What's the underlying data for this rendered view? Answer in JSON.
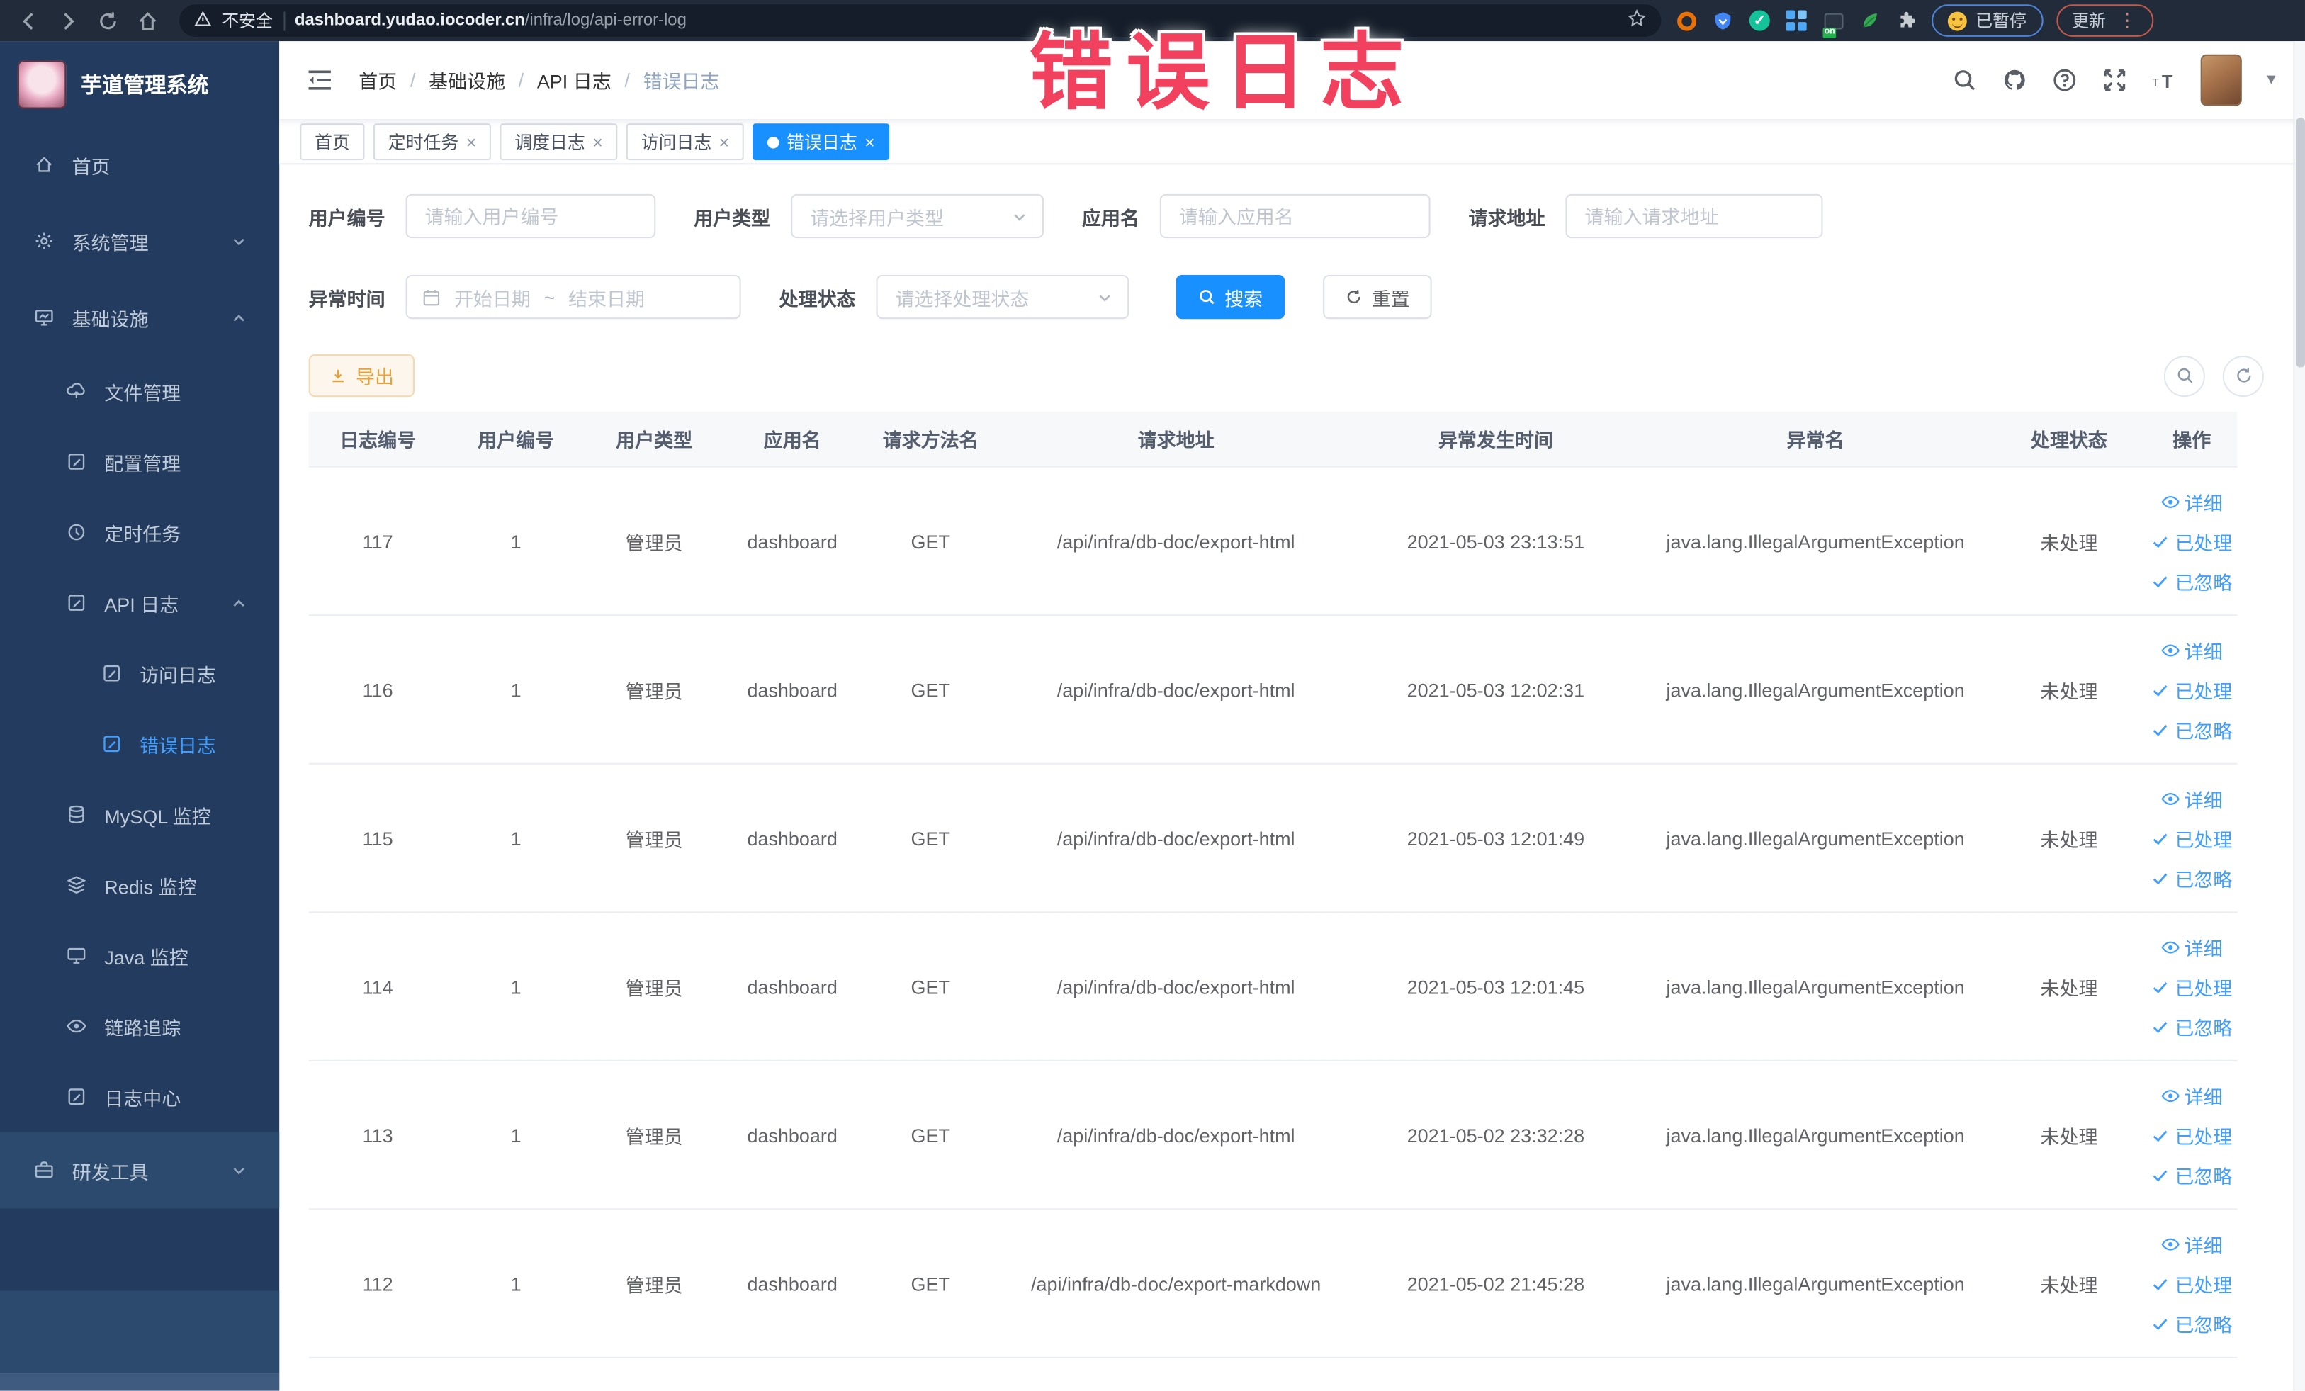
{
  "browser": {
    "security_label": "不安全",
    "url_domain": "dashboard.yudao.iocoder.cn",
    "url_path": "/infra/log/api-error-log",
    "paused_badge": "已暂停",
    "update_badge": "更新"
  },
  "watermark": "错误日志",
  "sidebar": {
    "app_title": "芋道管理系统",
    "items": [
      {
        "id": "home",
        "label": "首页",
        "icon": "home-icon",
        "level": 1
      },
      {
        "id": "system",
        "label": "系统管理",
        "icon": "gear-icon",
        "level": 1,
        "chevron": "down"
      },
      {
        "id": "infra",
        "label": "基础设施",
        "icon": "monitor-icon",
        "level": 1,
        "chevron": "up"
      },
      {
        "id": "file",
        "label": "文件管理",
        "icon": "cloud-upload-icon",
        "level": 2
      },
      {
        "id": "config",
        "label": "配置管理",
        "icon": "edit-icon",
        "level": 2
      },
      {
        "id": "job",
        "label": "定时任务",
        "icon": "clock-icon",
        "level": 2
      },
      {
        "id": "api-log",
        "label": "API 日志",
        "icon": "edit-icon",
        "level": 2,
        "chevron": "up"
      },
      {
        "id": "access-log",
        "label": "访问日志",
        "icon": "edit-icon",
        "level": 3
      },
      {
        "id": "error-log",
        "label": "错误日志",
        "icon": "edit-icon",
        "level": 3,
        "active": true
      },
      {
        "id": "mysql",
        "label": "MySQL 监控",
        "icon": "database-icon",
        "level": 2
      },
      {
        "id": "redis",
        "label": "Redis 监控",
        "icon": "layers-icon",
        "level": 2
      },
      {
        "id": "java",
        "label": "Java 监控",
        "icon": "desktop-icon",
        "level": 2
      },
      {
        "id": "trace",
        "label": "链路追踪",
        "icon": "eye-icon",
        "level": 2
      },
      {
        "id": "log-center",
        "label": "日志中心",
        "icon": "edit-icon",
        "level": 2
      },
      {
        "id": "devtools",
        "label": "研发工具",
        "icon": "toolbox-icon",
        "level": 1,
        "chevron": "down",
        "section": "light"
      }
    ]
  },
  "breadcrumb": [
    "首页",
    "基础设施",
    "API 日志",
    "错误日志"
  ],
  "tabs": [
    {
      "label": "首页",
      "closable": false,
      "active": false
    },
    {
      "label": "定时任务",
      "closable": true,
      "active": false
    },
    {
      "label": "调度日志",
      "closable": true,
      "active": false
    },
    {
      "label": "访问日志",
      "closable": true,
      "active": false
    },
    {
      "label": "错误日志",
      "closable": true,
      "active": true
    }
  ],
  "filters": {
    "user_id": {
      "label": "用户编号",
      "placeholder": "请输入用户编号"
    },
    "user_type": {
      "label": "用户类型",
      "placeholder": "请选择用户类型"
    },
    "app_name": {
      "label": "应用名",
      "placeholder": "请输入应用名"
    },
    "request_url": {
      "label": "请求地址",
      "placeholder": "请输入请求地址"
    },
    "exception_time": {
      "label": "异常时间",
      "start_placeholder": "开始日期",
      "separator": "~",
      "end_placeholder": "结束日期"
    },
    "process_status": {
      "label": "处理状态",
      "placeholder": "请选择处理状态"
    },
    "search_label": "搜索",
    "reset_label": "重置"
  },
  "toolbar": {
    "export_label": "导出"
  },
  "table": {
    "headers": [
      "日志编号",
      "用户编号",
      "用户类型",
      "应用名",
      "请求方法名",
      "请求地址",
      "异常发生时间",
      "异常名",
      "处理状态",
      "操作"
    ],
    "row_actions": [
      "详细",
      "已处理",
      "已忽略"
    ],
    "rows": [
      {
        "log_id": "117",
        "user_id": "1",
        "user_type": "管理员",
        "app": "dashboard",
        "method": "GET",
        "url": "/api/infra/db-doc/export-html",
        "time": "2021-05-03 23:13:51",
        "exception": "java.lang.IllegalArgumentException",
        "status": "未处理"
      },
      {
        "log_id": "116",
        "user_id": "1",
        "user_type": "管理员",
        "app": "dashboard",
        "method": "GET",
        "url": "/api/infra/db-doc/export-html",
        "time": "2021-05-03 12:02:31",
        "exception": "java.lang.IllegalArgumentException",
        "status": "未处理"
      },
      {
        "log_id": "115",
        "user_id": "1",
        "user_type": "管理员",
        "app": "dashboard",
        "method": "GET",
        "url": "/api/infra/db-doc/export-html",
        "time": "2021-05-03 12:01:49",
        "exception": "java.lang.IllegalArgumentException",
        "status": "未处理"
      },
      {
        "log_id": "114",
        "user_id": "1",
        "user_type": "管理员",
        "app": "dashboard",
        "method": "GET",
        "url": "/api/infra/db-doc/export-html",
        "time": "2021-05-03 12:01:45",
        "exception": "java.lang.IllegalArgumentException",
        "status": "未处理"
      },
      {
        "log_id": "113",
        "user_id": "1",
        "user_type": "管理员",
        "app": "dashboard",
        "method": "GET",
        "url": "/api/infra/db-doc/export-html",
        "time": "2021-05-02 23:32:28",
        "exception": "java.lang.IllegalArgumentException",
        "status": "未处理"
      },
      {
        "log_id": "112",
        "user_id": "1",
        "user_type": "管理员",
        "app": "dashboard",
        "method": "GET",
        "url": "/api/infra/db-doc/export-markdown",
        "time": "2021-05-02 21:45:28",
        "exception": "java.lang.IllegalArgumentException",
        "status": "未处理"
      }
    ]
  },
  "colors": {
    "accent_blue": "#1890ff",
    "link_blue": "#409eff",
    "warning_orange": "#e6a23c",
    "watermark_pink": "#f2415e",
    "sidebar_dark": "#233b5e",
    "sidebar_light": "#2b4a6e"
  }
}
